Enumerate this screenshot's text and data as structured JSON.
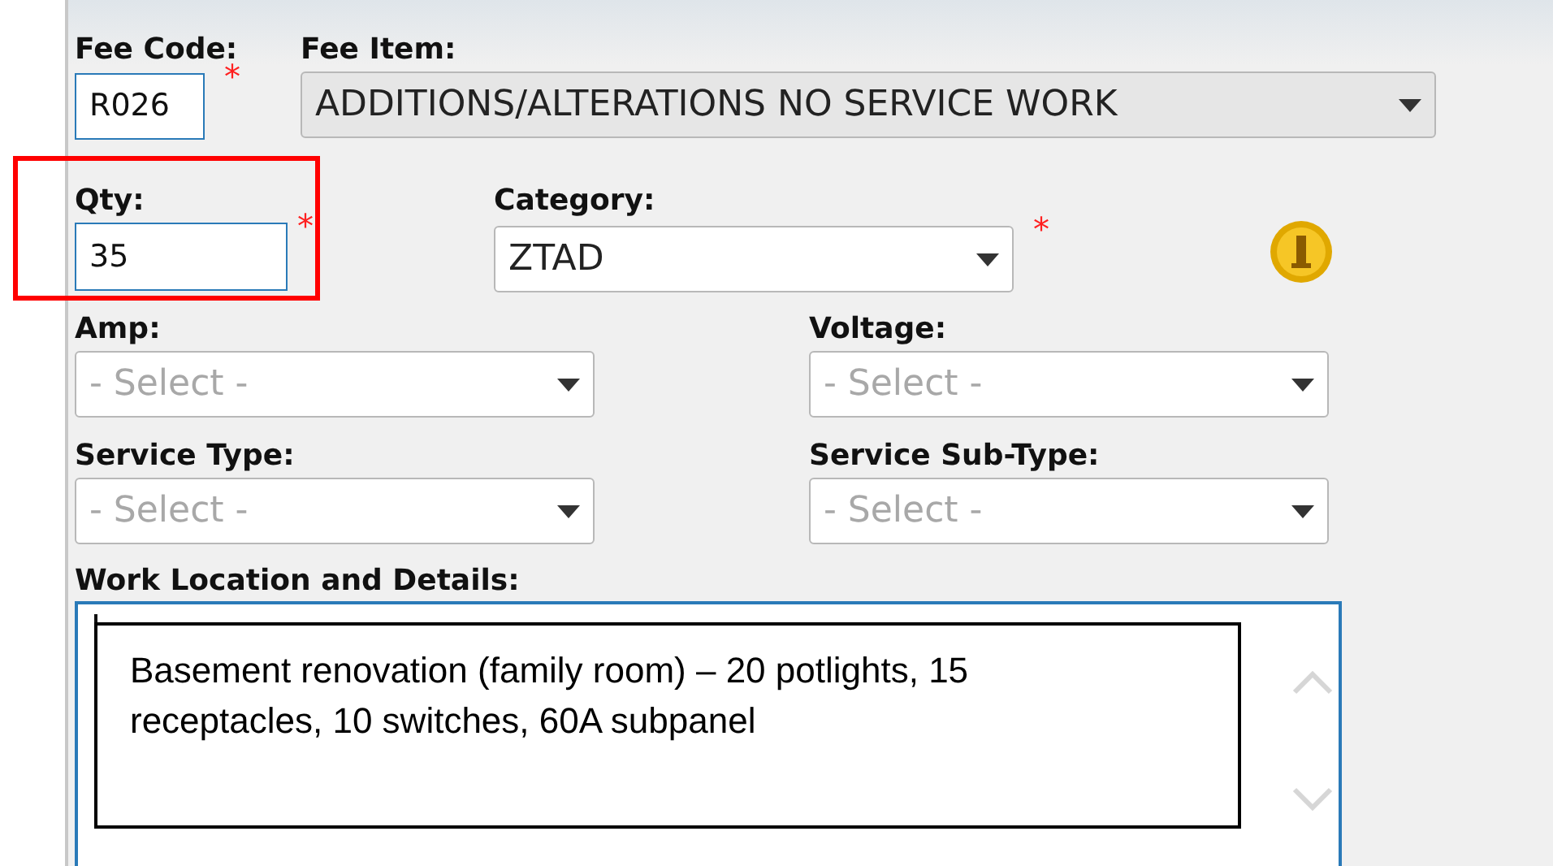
{
  "fee_code": {
    "label": "Fee Code:",
    "value": "R026",
    "required_mark": "*"
  },
  "fee_item": {
    "label": "Fee Item:",
    "value": "ADDITIONS/ALTERATIONS NO SERVICE WORK",
    "disabled": true
  },
  "qty": {
    "label": "Qty:",
    "value": "35",
    "required_mark": "*",
    "highlighted": true
  },
  "category": {
    "label": "Category:",
    "value": "ZTAD",
    "required_mark": "*"
  },
  "selects": [
    {
      "label": "Amp:",
      "placeholder": "- Select -"
    },
    {
      "label": "Voltage:",
      "placeholder": "- Select -"
    },
    {
      "label": "Service Type:",
      "placeholder": "- Select -"
    },
    {
      "label": "Service Sub-Type:",
      "placeholder": "- Select -"
    }
  ],
  "work_location": {
    "label": "Work Location and Details:"
  },
  "callout": {
    "text": "Basement renovation (family room) – 20 potlights, 15 receptacles, 10 switches, 60A subpanel"
  }
}
